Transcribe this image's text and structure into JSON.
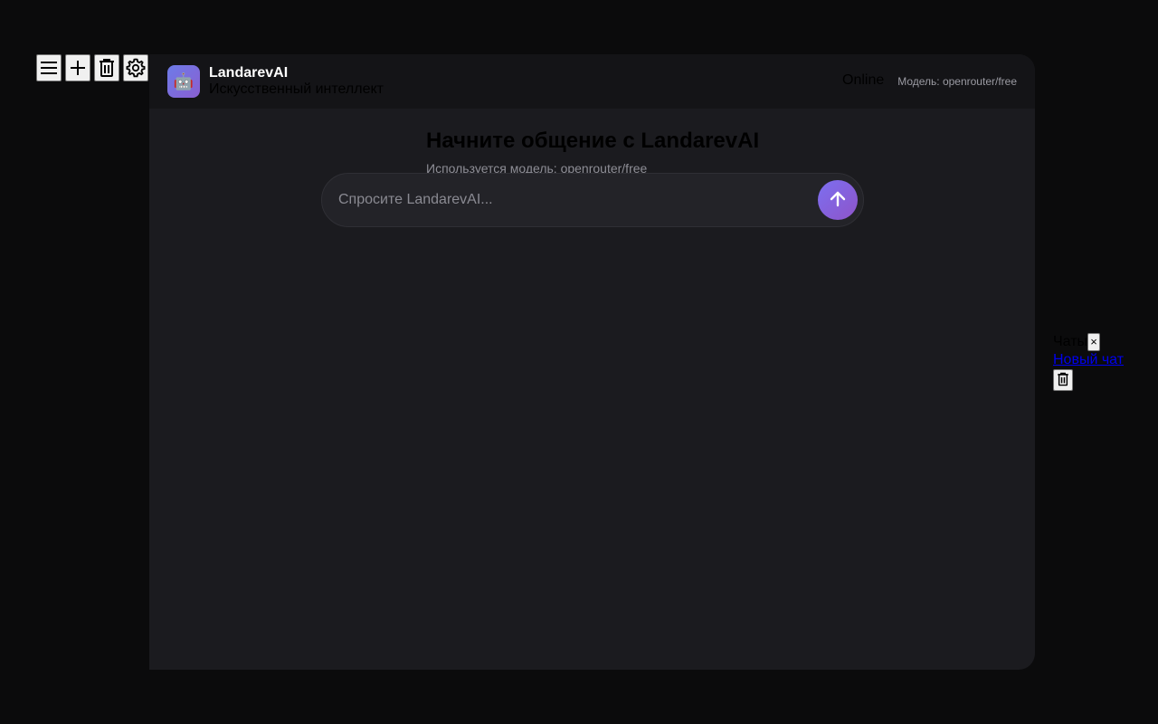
{
  "toolbar": {
    "icons": [
      "menu-icon",
      "plus-icon",
      "trash-icon",
      "gear-icon"
    ]
  },
  "header": {
    "avatar_icon": "🤖",
    "brand_name": "LandarevAI",
    "brand_subtitle": "Искусственный интеллект",
    "status": "Online",
    "model_label": "Модель: openrouter/free"
  },
  "welcome": {
    "title": "Начните общение с LandarevAI",
    "subtitle": "Используется модель: openrouter/free"
  },
  "composer": {
    "placeholder": "Спросите LandarevAI...",
    "value": ""
  },
  "side_panel": {
    "title": "Чаты",
    "close_label": "×",
    "new_chat_label": "Новый чат"
  },
  "colors": {
    "page_bg": "#0b0b0c",
    "chat_bg": "#1b1b1f",
    "header_bg": "#141417",
    "accent_start": "#7c6ff0",
    "accent_end": "#8e54c9"
  }
}
